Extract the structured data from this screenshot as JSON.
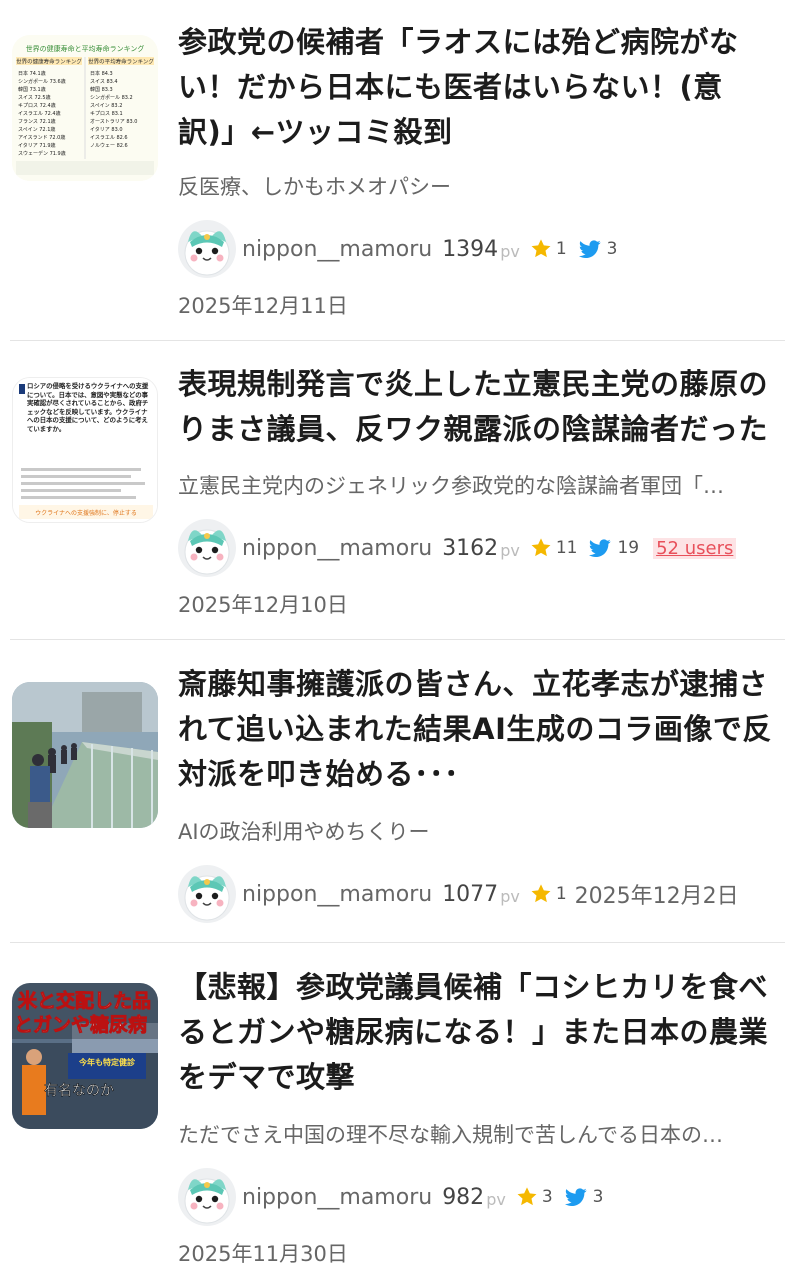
{
  "articles": [
    {
      "title": "参政党の候補者「ラオスには殆ど病院がない！だから日本にも医者はいらない！(意訳)」←ツッコミ殺到",
      "summary": "反医療、しかもホメオパシー",
      "author": "nippon__mamoru",
      "pv": "1394",
      "pv_unit": "pv",
      "stars": "1",
      "tweets": "3",
      "date": "2025年12月11日",
      "thumb_icon": "ranking-table-image",
      "thumb_text": {
        "head1": "世界の健康寿命と平均寿命ランキング",
        "left_title": "世界の健康寿命ランキング",
        "right_title": "世界の平均寿命ランキング",
        "left_rows": [
          "日本 74.1歳",
          "シンガポール 73.6歳",
          "韓国 73.1歳",
          "スイス 72.5歳",
          "キプロス 72.4歳",
          "イスラエル 72.4歳",
          "フランス 72.1歳",
          "スペイン 72.1歳",
          "アイスランド 72.0歳",
          "イタリア 71.9歳",
          "スウェーデン 71.9歳"
        ],
        "right_rows": [
          "日本 84.3",
          "スイス 83.4",
          "韓国 83.3",
          "シンガポール 83.2",
          "スペイン 83.2",
          "キプロス 83.1",
          "オーストラリア 83.0",
          "イタリア 83.0",
          "イスラエル 82.6",
          "ノルウェー 82.6"
        ]
      }
    },
    {
      "title": "表現規制発言で炎上した立憲民主党の藤原のりまさ議員、反ワク親露派の陰謀論者だった",
      "summary": "立憲民主党内のジェネリック参政党的な陰謀論者軍団「…",
      "author": "nippon__mamoru",
      "pv": "3162",
      "pv_unit": "pv",
      "stars": "11",
      "tweets": "19",
      "users": "52 users",
      "date": "2025年12月10日",
      "thumb_icon": "document-screenshot-image",
      "thumb_text": {
        "heading": "ロシアの侵略を受けるウクライナへの支援について。日本では、意図や実態などの事実確認が尽くされていることから、政府チェックなどを反映しています。ウクライナへの日本の支援について、どのように考えていますか。",
        "footer": "ウクライナへの支援強制に、停止する"
      }
    },
    {
      "title": "斎藤知事擁護派の皆さん、立花孝志が逮捕されて追い込まれた結果AI生成のコラ画像で反対派を叩き始める･･･",
      "summary": "AIの政治利用やめちくりー",
      "author": "nippon__mamoru",
      "pv": "1077",
      "pv_unit": "pv",
      "stars": "1",
      "date": "2025年12月2日",
      "thumb_icon": "crowd-on-bridge-photo"
    },
    {
      "title": "【悲報】参政党議員候補「コシヒカリを食べるとガンや糖尿病になる！」また日本の農業をデマで攻撃",
      "summary": "ただでさえ中国の理不尽な輸入規制で苦しんでる日本の…",
      "author": "nippon__mamoru",
      "pv": "982",
      "pv_unit": "pv",
      "stars": "3",
      "tweets": "3",
      "date": "2025年11月30日",
      "thumb_icon": "speech-video-still",
      "thumb_text": {
        "line1": "米と交配した品",
        "line2": "とガンや糖尿病",
        "caption": "有名なのか",
        "banner": "今年も特定健診"
      }
    }
  ]
}
